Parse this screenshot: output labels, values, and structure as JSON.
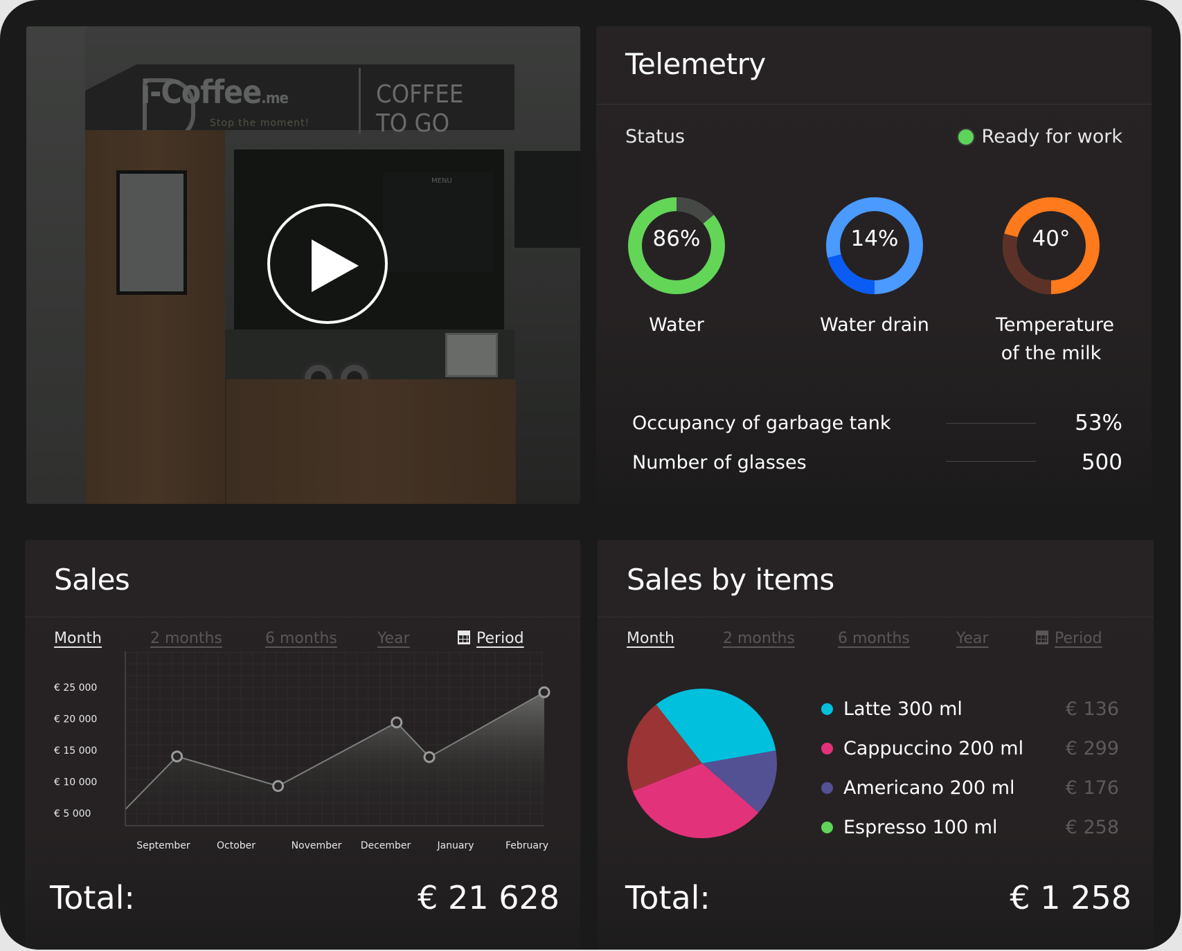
{
  "video": {
    "brand_text": "i-Coffee",
    "brand_suffix": ".me",
    "tagline": "Stop the moment!",
    "sign_line1": "COFFEE",
    "sign_line2": "TO GO",
    "menu_label": "MENU",
    "play_icon": "play-icon"
  },
  "telemetry": {
    "title": "Telemetry",
    "status_label": "Status",
    "status_value": "Ready for work",
    "status_color": "#5cd45a",
    "gauges": [
      {
        "label": "Water",
        "label2": "",
        "value_text": "86%",
        "percent": 86,
        "main_color": "#63d658",
        "secondary_color": "#464846",
        "secondary_fraction": 0.14
      },
      {
        "label": "Water drain",
        "label2": "",
        "value_text": "14%",
        "percent": 14,
        "main_color": "#4a9aff",
        "secondary_color": "#0a5cf5",
        "secondary_fraction": 0.21
      },
      {
        "label": "Temperature",
        "label2": "of the milk",
        "value_text": "40°",
        "percent": 40,
        "main_color": "#ff7a1c",
        "secondary_color": "#5c3127",
        "secondary_fraction": 0.29
      }
    ],
    "metrics": [
      {
        "label": "Occupancy of garbage tank",
        "value": "53%"
      },
      {
        "label": "Number of glasses",
        "value": "500"
      }
    ]
  },
  "sales": {
    "title": "Sales",
    "tabs": [
      "Month",
      "2 months",
      "6 months",
      "Year",
      "Period"
    ],
    "active_tab": "Month",
    "total_label": "Total:",
    "total_value": "€ 21 628"
  },
  "sales_by_items": {
    "title": "Sales by items",
    "tabs": [
      "Month",
      "2 months",
      "6 months",
      "Year",
      "Period"
    ],
    "active_tab": "Month",
    "total_label": "Total:",
    "total_value": "€ 1 258",
    "legend": [
      {
        "label": "Latte 300 ml",
        "value": "€ 136",
        "color": "#00c0dd"
      },
      {
        "label": "Cappuccino 200 ml",
        "value": "€ 299",
        "color": "#e2327a"
      },
      {
        "label": "Americano 200 ml",
        "value": "€ 176",
        "color": "#545094"
      },
      {
        "label": "Espresso 100 ml",
        "value": "€ 258",
        "color": "#5fd457"
      }
    ]
  },
  "chart_data": [
    {
      "type": "area",
      "title": "Sales",
      "xlabel": "",
      "ylabel": "",
      "categories": [
        "September",
        "October",
        "November",
        "December",
        "January",
        "February"
      ],
      "x_note": "x values are fractional category indices (0 = September)",
      "xlim": [
        -0.53,
        5.23
      ],
      "ylim": [
        3000,
        28500
      ],
      "yticks": [
        5000,
        10000,
        15000,
        20000,
        25000
      ],
      "ytick_labels": [
        "€ 5 000",
        "€ 10 000",
        "€ 15 000",
        "€ 20 000",
        "€ 25 000"
      ],
      "grid": true,
      "series": [
        {
          "name": "Sales",
          "x": [
            -0.53,
            0.18,
            1.57,
            3.2,
            3.65,
            5.23
          ],
          "values": [
            5600,
            14000,
            9300,
            19400,
            13900,
            24200
          ],
          "markers": [
            false,
            true,
            true,
            true,
            true,
            true
          ]
        }
      ]
    },
    {
      "type": "pie",
      "title": "Sales by items",
      "start_angle_deg": 322,
      "slices": [
        {
          "name": "Latte 300 ml",
          "fraction": 0.328,
          "color": "#00c0dd"
        },
        {
          "name": "Americano 200 ml",
          "fraction": 0.142,
          "color": "#545094"
        },
        {
          "name": "Cappuccino 200 ml",
          "fraction": 0.325,
          "color": "#e2327a"
        },
        {
          "name": "Espresso 100 ml",
          "fraction": 0.205,
          "color": "#9b3434"
        }
      ]
    }
  ]
}
